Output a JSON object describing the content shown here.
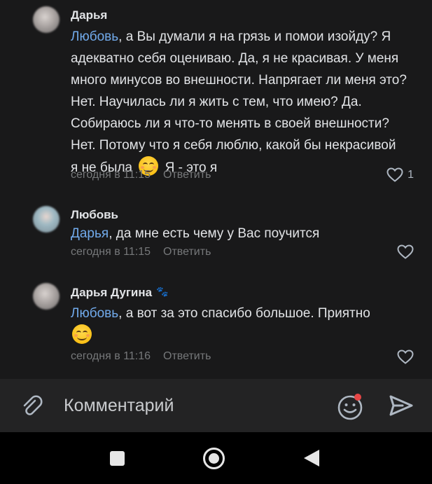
{
  "comments": [
    {
      "author": "Дарья",
      "mention": "Любовь",
      "text": ", а Вы думали я на грязь и помои изойду? Я адекватно себя оцениваю. Да, я не красивая. У меня много минусов во внешности. Напрягает ли меня это? Нет. Научилась ли я жить с тем, что имею? Да. Собираюсь ли я что-то менять в своей внешности? Нет. Потому что я себя люблю, какой бы некрасивой я не была",
      "text_after_emoji": "Я - это я",
      "time": "сегодня в 11:15",
      "reply_label": "Ответить",
      "likes": "1"
    },
    {
      "author": "Любовь",
      "mention": "Дарья",
      "text": ", да мне есть чему у Вас поучится",
      "time": "сегодня в 11:15",
      "reply_label": "Ответить"
    },
    {
      "author": "Дарья Дугина",
      "author_badge_icon": "paw-icon",
      "mention": "Любовь",
      "text": ", а вот за это спасибо большое. Приятно",
      "time": "сегодня в 11:16",
      "reply_label": "Ответить"
    }
  ],
  "composer": {
    "placeholder": "Комментарий",
    "attach_icon": "paperclip-icon",
    "emoji_icon": "smile-icon",
    "send_icon": "send-icon"
  },
  "navbar": {
    "recents_icon": "square-icon",
    "home_icon": "circle-icon",
    "back_icon": "triangle-back-icon"
  },
  "colors": {
    "background": "#19191a",
    "mention": "#71aaeb",
    "meta": "#76787a",
    "composer_bg": "#232324",
    "notification_dot": "#e64646"
  }
}
